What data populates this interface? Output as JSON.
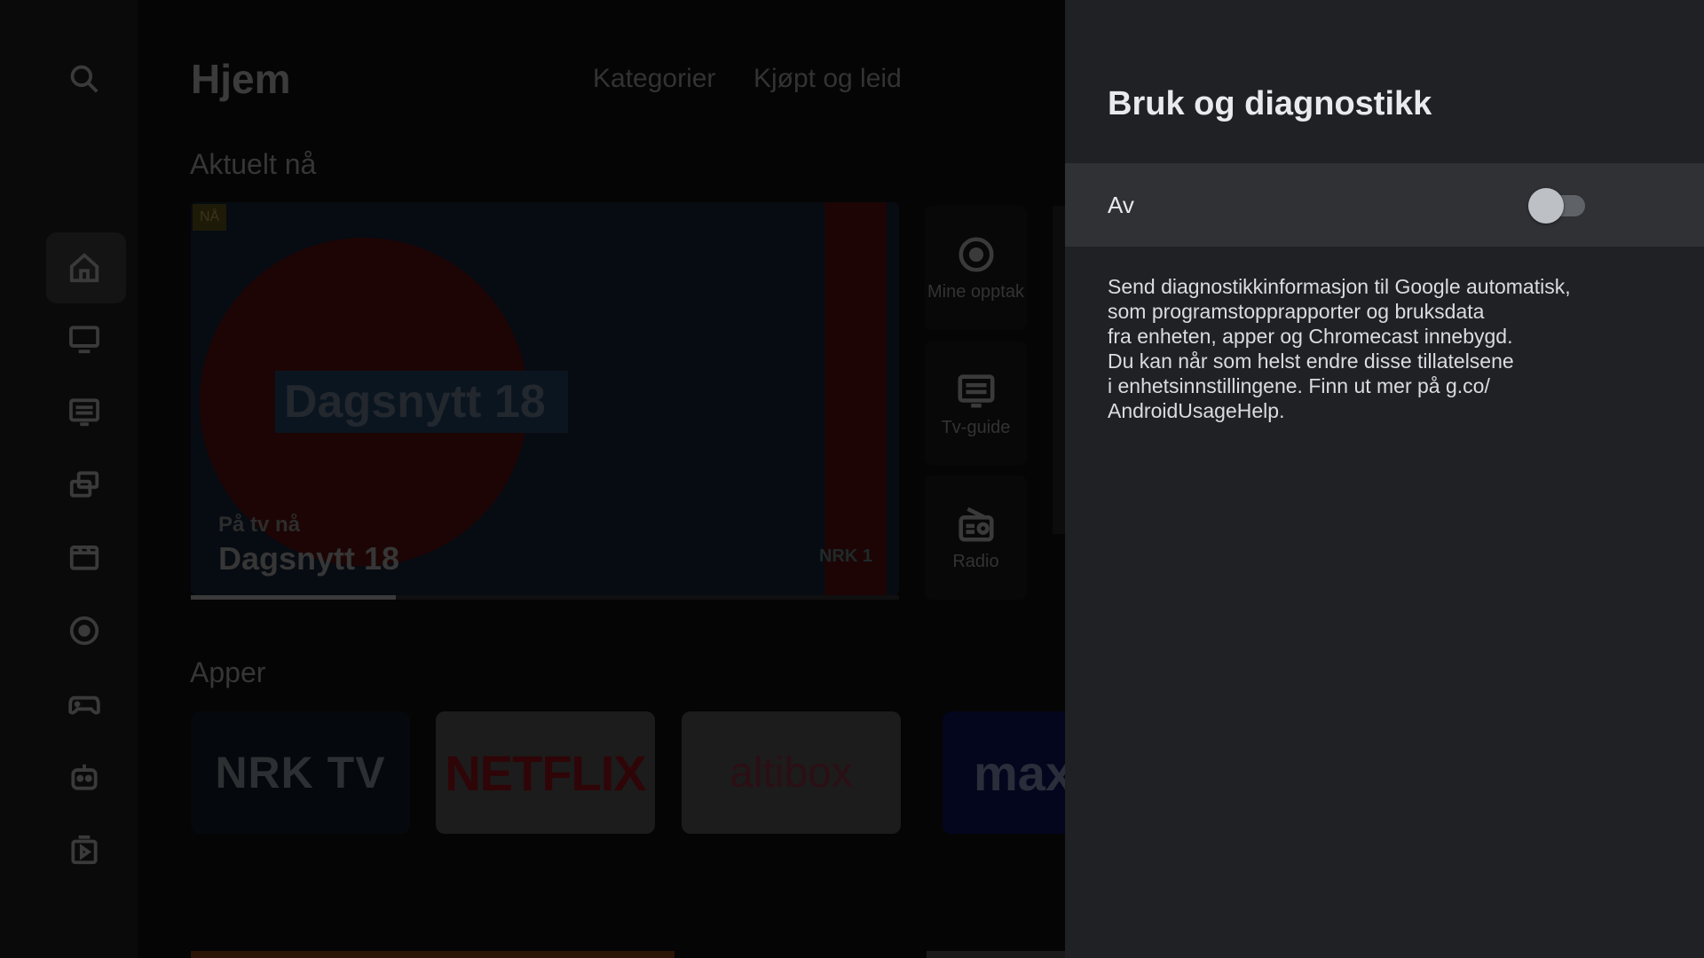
{
  "home": {
    "title": "Hjem",
    "tabs": [
      "Kategorier",
      "Kjøpt og leid"
    ],
    "section_current": "Aktuelt nå",
    "hero": {
      "badge": "NÅ",
      "show_graphic_text": "Dagsnytt 18",
      "on_tv_label": "På tv nå",
      "program_title": "Dagsnytt 18",
      "channel": "NRK 1",
      "progress": 0.29
    },
    "side_tiles": [
      {
        "icon": "record-icon",
        "label": "Mine opptak"
      },
      {
        "icon": "tv-guide-icon",
        "label": "Tv-guide"
      },
      {
        "icon": "radio-icon",
        "label": "Radio"
      }
    ],
    "section_apps": "Apper",
    "apps": [
      "NRK TV",
      "NETFLIX",
      "altibox",
      "max"
    ],
    "nav_icons": [
      "search-icon",
      "home-icon",
      "tv-icon",
      "guide-icon",
      "multiscreen-icon",
      "movies-icon",
      "recordings-icon",
      "games-icon",
      "kids-icon",
      "apps-icon"
    ]
  },
  "panel": {
    "title": "Bruk og diagnostikk",
    "toggle": {
      "label": "Av",
      "on": false
    },
    "description_lines": [
      "Send diagnostikkinformasjon til Google automatisk,",
      "som programstopprapporter og bruksdata",
      "fra enheten, apper og Chromecast innebygd.",
      "Du kan når som helst endre disse tillatelsene",
      "i enhetsinnstillingene. Finn ut mer på g.co/",
      "AndroidUsageHelp."
    ]
  },
  "colors": {
    "panel_bg": "#202124",
    "row_bg": "#303134",
    "text_primary": "#e8eaed",
    "toggle_track_off": "#5f6368",
    "toggle_thumb_off": "#bdc1c6"
  }
}
